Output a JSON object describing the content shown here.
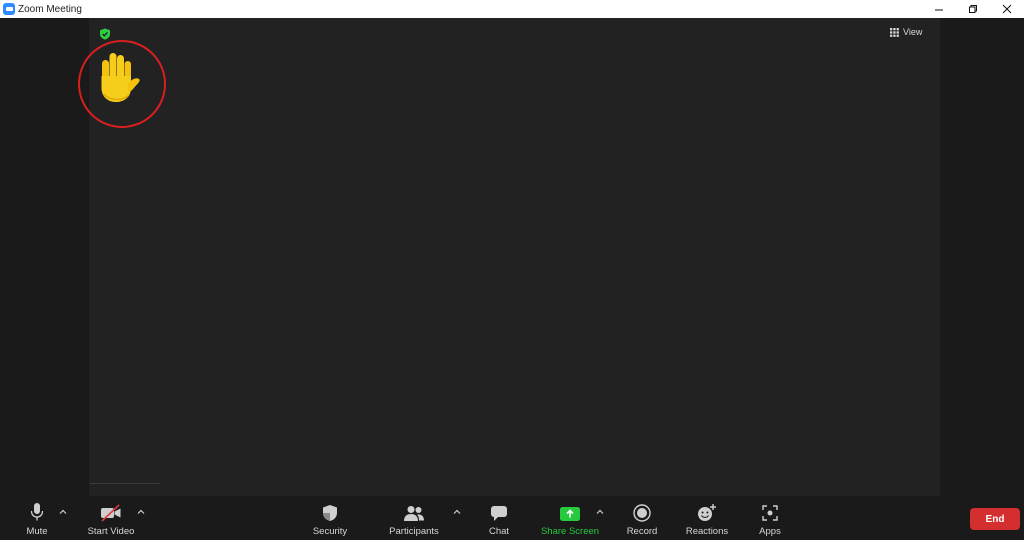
{
  "window": {
    "title": "Zoom Meeting",
    "controls": [
      "minimize",
      "restore",
      "close"
    ]
  },
  "stage": {
    "view_label": "View",
    "raised_hand": "✋"
  },
  "toolbar": {
    "mute_label": "Mute",
    "start_video_label": "Start Video",
    "security_label": "Security",
    "participants_label": "Participants",
    "chat_label": "Chat",
    "share_screen_label": "Share Screen",
    "record_label": "Record",
    "reactions_label": "Reactions",
    "apps_label": "Apps",
    "end_label": "End"
  },
  "colors": {
    "share_green": "#27c93f",
    "end_red": "#d32f2f",
    "highlight_ring": "#d9201f",
    "secure_shield": "#2ecc40"
  },
  "icons": {
    "mute": "microphone-icon",
    "video": "video-off-icon",
    "security": "shield-icon",
    "participants": "people-icon",
    "chat": "chat-bubble-icon",
    "share": "share-screen-icon",
    "record": "record-icon",
    "reactions": "emoji-plus-icon",
    "apps": "apps-icon"
  }
}
